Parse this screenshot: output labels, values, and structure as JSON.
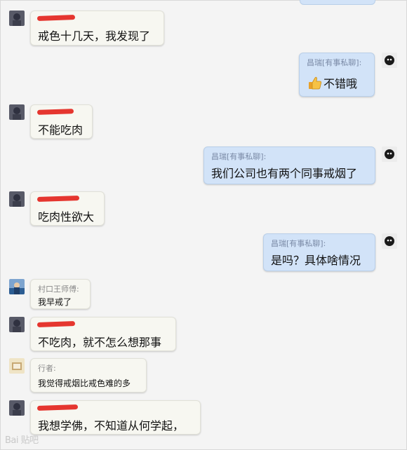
{
  "messages": [
    {
      "side": "left",
      "name": "",
      "redacted": true,
      "text": "戒色十几天，我发现了"
    },
    {
      "side": "right",
      "name": "昌瑞[有事私聊]:",
      "text": "不错哦",
      "thumb": true
    },
    {
      "side": "left",
      "name": "",
      "redacted": true,
      "text": "不能吃肉"
    },
    {
      "side": "right",
      "name": "昌瑞[有事私聊]:",
      "text": "我们公司也有两个同事戒烟了"
    },
    {
      "side": "left",
      "name": "",
      "redacted": true,
      "text": "吃肉性欲大"
    },
    {
      "side": "right",
      "name": "昌瑞[有事私聊]:",
      "text": "是吗？具体啥情况"
    },
    {
      "side": "left",
      "name": "村口王师傅:",
      "text": "我早戒了"
    },
    {
      "side": "left",
      "name": "",
      "redacted": true,
      "text": "不吃肉，就不怎么想那事"
    },
    {
      "side": "left",
      "name": "行者:",
      "text": "我觉得戒烟比戒色难的多"
    },
    {
      "side": "left",
      "name": "",
      "redacted": true,
      "text": "我想学佛，不知道从何学起，"
    }
  ],
  "watermark": "Bai 贴吧",
  "colors": {
    "left_bubble": "#f7f7f1",
    "right_bubble": "#d2e3f8",
    "redaction": "#e5362f",
    "name_text": "#7a8aa6"
  }
}
